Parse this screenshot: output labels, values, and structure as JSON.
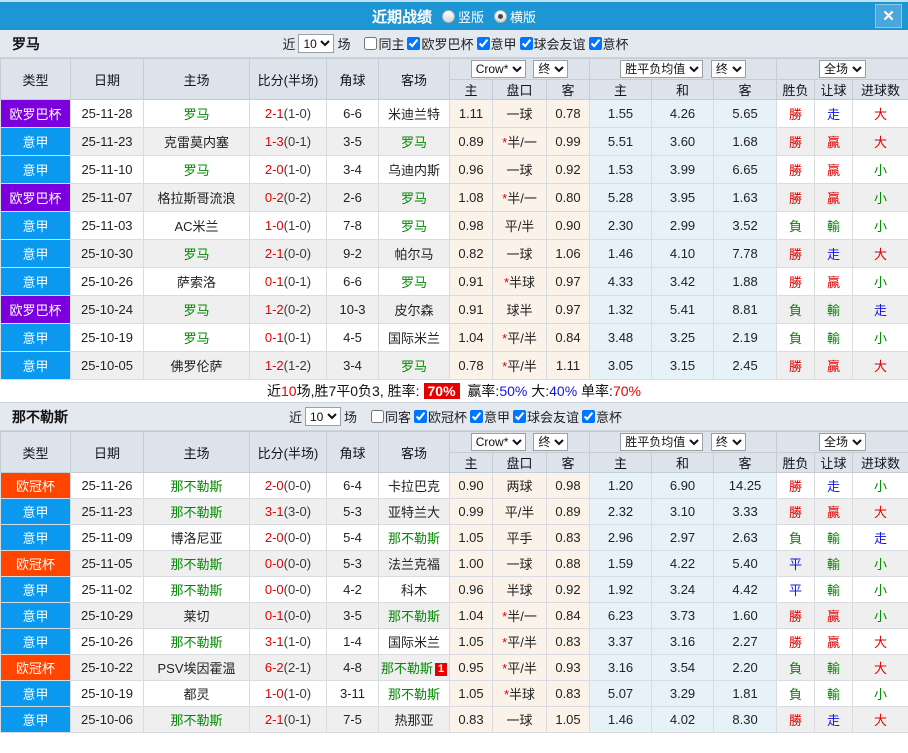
{
  "titlebar": {
    "title": "近期战绩",
    "vertical_label": "竖版",
    "horizontal_label": "横版",
    "selected_layout": "横版",
    "close_glyph": "✕",
    "bar_color": "#1e96d4"
  },
  "columns": {
    "type": "类型",
    "date": "日期",
    "home": "主场",
    "score": "比分(半场)",
    "corner": "角球",
    "away": "客场",
    "host": "主",
    "handicap": "盘口",
    "guest": "客",
    "win": "主",
    "draw": "和",
    "lose": "客",
    "result": "胜负",
    "let_ball": "让球",
    "goals": "进球数"
  },
  "type_colors": {
    "欧罗巴杯": "#7b00dd",
    "意甲": "#0a99ee",
    "欧冠杯": "#ff4400"
  },
  "result_colors": {
    "win": "#e10000",
    "lose": "#008a00",
    "draw": "#1414e0"
  },
  "result_color_map": {
    "勝": "win",
    "贏": "win",
    "大": "win",
    "負": "lose",
    "輸": "lose",
    "小": "lose",
    "平": "draw",
    "走": "draw"
  },
  "teams": [
    {
      "name": "罗马",
      "filter": {
        "near_label": "近",
        "count": "10",
        "games_label": "场",
        "same_label": "同主",
        "same_checked": false,
        "comps": [
          "欧罗巴杯",
          "意甲",
          "球会友谊",
          "意杯"
        ],
        "comps_checked": [
          true,
          true,
          true,
          true
        ]
      },
      "selects": {
        "company": "Crow*",
        "company_time": "终",
        "wdl": "胜平负均值",
        "wdl_time": "终",
        "scope": "全场"
      },
      "rows": [
        {
          "type": "欧罗巴杯",
          "date": "25-11-28",
          "home": "罗马",
          "ht": true,
          "score": "2-1",
          "half": "(1-0)",
          "corner": "6-6",
          "away": "米迪兰特",
          "at": false,
          "h": "1.11",
          "pan": "一球",
          "a": "0.78",
          "w": "1.55",
          "d": "4.26",
          "l": "5.65",
          "sf": "勝",
          "rq": "走",
          "jq": "大"
        },
        {
          "type": "意甲",
          "date": "25-11-23",
          "home": "克雷莫内塞",
          "ht": false,
          "score": "1-3",
          "half": "(0-1)",
          "corner": "3-5",
          "away": "罗马",
          "at": true,
          "h": "0.89",
          "pan": "*半/一",
          "a": "0.99",
          "w": "5.51",
          "d": "3.60",
          "l": "1.68",
          "sf": "勝",
          "rq": "贏",
          "jq": "大"
        },
        {
          "type": "意甲",
          "date": "25-11-10",
          "home": "罗马",
          "ht": true,
          "score": "2-0",
          "half": "(1-0)",
          "corner": "3-4",
          "away": "乌迪内斯",
          "at": false,
          "h": "0.96",
          "pan": "一球",
          "a": "0.92",
          "w": "1.53",
          "d": "3.99",
          "l": "6.65",
          "sf": "勝",
          "rq": "贏",
          "jq": "小"
        },
        {
          "type": "欧罗巴杯",
          "date": "25-11-07",
          "home": "格拉斯哥流浪",
          "ht": false,
          "score": "0-2",
          "half": "(0-2)",
          "corner": "2-6",
          "away": "罗马",
          "at": true,
          "h": "1.08",
          "pan": "*半/一",
          "a": "0.80",
          "w": "5.28",
          "d": "3.95",
          "l": "1.63",
          "sf": "勝",
          "rq": "贏",
          "jq": "小"
        },
        {
          "type": "意甲",
          "date": "25-11-03",
          "home": "AC米兰",
          "ht": false,
          "score": "1-0",
          "half": "(1-0)",
          "corner": "7-8",
          "away": "罗马",
          "at": true,
          "h": "0.98",
          "pan": "平/半",
          "a": "0.90",
          "w": "2.30",
          "d": "2.99",
          "l": "3.52",
          "sf": "負",
          "rq": "輸",
          "jq": "小"
        },
        {
          "type": "意甲",
          "date": "25-10-30",
          "home": "罗马",
          "ht": true,
          "score": "2-1",
          "half": "(0-0)",
          "corner": "9-2",
          "away": "帕尔马",
          "at": false,
          "h": "0.82",
          "pan": "一球",
          "a": "1.06",
          "w": "1.46",
          "d": "4.10",
          "l": "7.78",
          "sf": "勝",
          "rq": "走",
          "jq": "大"
        },
        {
          "type": "意甲",
          "date": "25-10-26",
          "home": "萨索洛",
          "ht": false,
          "score": "0-1",
          "half": "(0-1)",
          "corner": "6-6",
          "away": "罗马",
          "at": true,
          "h": "0.91",
          "pan": "*半球",
          "a": "0.97",
          "w": "4.33",
          "d": "3.42",
          "l": "1.88",
          "sf": "勝",
          "rq": "贏",
          "jq": "小"
        },
        {
          "type": "欧罗巴杯",
          "date": "25-10-24",
          "home": "罗马",
          "ht": true,
          "score": "1-2",
          "half": "(0-2)",
          "corner": "10-3",
          "away": "皮尔森",
          "at": false,
          "h": "0.91",
          "pan": "球半",
          "a": "0.97",
          "w": "1.32",
          "d": "5.41",
          "l": "8.81",
          "sf": "負",
          "rq": "輸",
          "jq": "走"
        },
        {
          "type": "意甲",
          "date": "25-10-19",
          "home": "罗马",
          "ht": true,
          "score": "0-1",
          "half": "(0-1)",
          "corner": "4-5",
          "away": "国际米兰",
          "at": false,
          "h": "1.04",
          "pan": "*平/半",
          "a": "0.84",
          "w": "3.48",
          "d": "3.25",
          "l": "2.19",
          "sf": "負",
          "rq": "輸",
          "jq": "小"
        },
        {
          "type": "意甲",
          "date": "25-10-05",
          "home": "佛罗伦萨",
          "ht": false,
          "score": "1-2",
          "half": "(1-2)",
          "corner": "3-4",
          "away": "罗马",
          "at": true,
          "h": "0.78",
          "pan": "*平/半",
          "a": "1.11",
          "w": "3.05",
          "d": "3.15",
          "l": "2.45",
          "sf": "勝",
          "rq": "贏",
          "jq": "大"
        }
      ],
      "summary": [
        {
          "text": "近",
          "style": "plain"
        },
        {
          "text": "10",
          "style": "red"
        },
        {
          "text": "场,胜7平0负3, 胜率:",
          "style": "plain"
        },
        {
          "text": "70%",
          "style": "badge"
        },
        {
          "text": " 赢率:",
          "style": "plain"
        },
        {
          "text": "50%",
          "style": "blue"
        },
        {
          "text": " 大:",
          "style": "plain"
        },
        {
          "text": "40%",
          "style": "blue"
        },
        {
          "text": " 单率:",
          "style": "plain"
        },
        {
          "text": "70%",
          "style": "red"
        }
      ]
    },
    {
      "name": "那不勒斯",
      "filter": {
        "near_label": "近",
        "count": "10",
        "games_label": "场",
        "same_label": "同客",
        "same_checked": false,
        "comps": [
          "欧冠杯",
          "意甲",
          "球会友谊",
          "意杯"
        ],
        "comps_checked": [
          true,
          true,
          true,
          true
        ]
      },
      "selects": {
        "company": "Crow*",
        "company_time": "终",
        "wdl": "胜平负均值",
        "wdl_time": "终",
        "scope": "全场"
      },
      "rows": [
        {
          "type": "欧冠杯",
          "date": "25-11-26",
          "home": "那不勒斯",
          "ht": true,
          "score": "2-0",
          "half": "(0-0)",
          "corner": "6-4",
          "away": "卡拉巴克",
          "at": false,
          "h": "0.90",
          "pan": "两球",
          "a": "0.98",
          "w": "1.20",
          "d": "6.90",
          "l": "14.25",
          "sf": "勝",
          "rq": "走",
          "jq": "小"
        },
        {
          "type": "意甲",
          "date": "25-11-23",
          "home": "那不勒斯",
          "ht": true,
          "score": "3-1",
          "half": "(3-0)",
          "corner": "5-3",
          "away": "亚特兰大",
          "at": false,
          "h": "0.99",
          "pan": "平/半",
          "a": "0.89",
          "w": "2.32",
          "d": "3.10",
          "l": "3.33",
          "sf": "勝",
          "rq": "贏",
          "jq": "大"
        },
        {
          "type": "意甲",
          "date": "25-11-09",
          "home": "博洛尼亚",
          "ht": false,
          "score": "2-0",
          "half": "(0-0)",
          "corner": "5-4",
          "away": "那不勒斯",
          "at": true,
          "h": "1.05",
          "pan": "平手",
          "a": "0.83",
          "w": "2.96",
          "d": "2.97",
          "l": "2.63",
          "sf": "負",
          "rq": "輸",
          "jq": "走"
        },
        {
          "type": "欧冠杯",
          "date": "25-11-05",
          "home": "那不勒斯",
          "ht": true,
          "score": "0-0",
          "half": "(0-0)",
          "corner": "5-3",
          "away": "法兰克福",
          "at": false,
          "h": "1.00",
          "pan": "一球",
          "a": "0.88",
          "w": "1.59",
          "d": "4.22",
          "l": "5.40",
          "sf": "平",
          "rq": "輸",
          "jq": "小"
        },
        {
          "type": "意甲",
          "date": "25-11-02",
          "home": "那不勒斯",
          "ht": true,
          "score": "0-0",
          "half": "(0-0)",
          "corner": "4-2",
          "away": "科木",
          "at": false,
          "h": "0.96",
          "pan": "半球",
          "a": "0.92",
          "w": "1.92",
          "d": "3.24",
          "l": "4.42",
          "sf": "平",
          "rq": "輸",
          "jq": "小"
        },
        {
          "type": "意甲",
          "date": "25-10-29",
          "home": "莱切",
          "ht": false,
          "score": "0-1",
          "half": "(0-0)",
          "corner": "3-5",
          "away": "那不勒斯",
          "at": true,
          "h": "1.04",
          "pan": "*半/一",
          "a": "0.84",
          "w": "6.23",
          "d": "3.73",
          "l": "1.60",
          "sf": "勝",
          "rq": "贏",
          "jq": "小"
        },
        {
          "type": "意甲",
          "date": "25-10-26",
          "home": "那不勒斯",
          "ht": true,
          "score": "3-1",
          "half": "(1-0)",
          "corner": "1-4",
          "away": "国际米兰",
          "at": false,
          "h": "1.05",
          "pan": "*平/半",
          "a": "0.83",
          "w": "3.37",
          "d": "3.16",
          "l": "2.27",
          "sf": "勝",
          "rq": "贏",
          "jq": "大"
        },
        {
          "type": "欧冠杯",
          "date": "25-10-22",
          "home": "PSV埃因霍温",
          "ht": false,
          "score": "6-2",
          "half": "(2-1)",
          "corner": "4-8",
          "away": "那不勒斯",
          "at": true,
          "badge": "1",
          "h": "0.95",
          "pan": "*平/半",
          "a": "0.93",
          "w": "3.16",
          "d": "3.54",
          "l": "2.20",
          "sf": "負",
          "rq": "輸",
          "jq": "大"
        },
        {
          "type": "意甲",
          "date": "25-10-19",
          "home": "都灵",
          "ht": false,
          "score": "1-0",
          "half": "(1-0)",
          "corner": "3-11",
          "away": "那不勒斯",
          "at": true,
          "h": "1.05",
          "pan": "*半球",
          "a": "0.83",
          "w": "5.07",
          "d": "3.29",
          "l": "1.81",
          "sf": "負",
          "rq": "輸",
          "jq": "小"
        },
        {
          "type": "意甲",
          "date": "25-10-06",
          "home": "那不勒斯",
          "ht": true,
          "score": "2-1",
          "half": "(0-1)",
          "corner": "7-5",
          "away": "热那亚",
          "at": false,
          "h": "0.83",
          "pan": "一球",
          "a": "1.05",
          "w": "1.46",
          "d": "4.02",
          "l": "8.30",
          "sf": "勝",
          "rq": "走",
          "jq": "大"
        }
      ],
      "summary": null
    }
  ]
}
